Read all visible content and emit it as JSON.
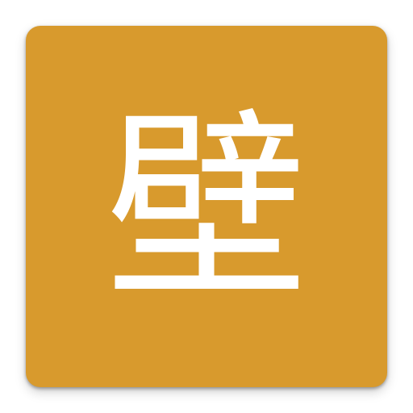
{
  "icon": {
    "glyph": "壁",
    "background_color": "#D89A2D",
    "glyph_color": "#FFFFFF"
  }
}
